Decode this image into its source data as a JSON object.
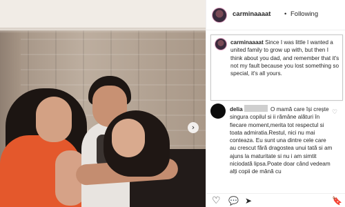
{
  "post": {
    "username": "carminaaaat",
    "follow_status": "Following",
    "separator": "•"
  },
  "caption": {
    "username": "carminaaaat",
    "text": "Since I was little I wanted a united family to grow up with, but then I think about you dad, and remember that it's not my fault because you lost something so special, it's all yours."
  },
  "comment": {
    "username": "delia",
    "text": "O mamă care își crește singura copilul si ii rămâne alături în fiecare moment,merita tot respectul si toata admiratia.Restul, nici nu mai conteaza. Eu sunt una dintre cele care au crescut fără dragostea unui tată si am ajuns la maturitate si nu i am simtit niciodată lipsa.Poate doar când vedeam alți copii de mână cu"
  },
  "icons": {
    "carousel_next": "›",
    "comment_like": "♡",
    "like": "♡",
    "comment": "💬",
    "share": "➤",
    "save": "🔖"
  }
}
